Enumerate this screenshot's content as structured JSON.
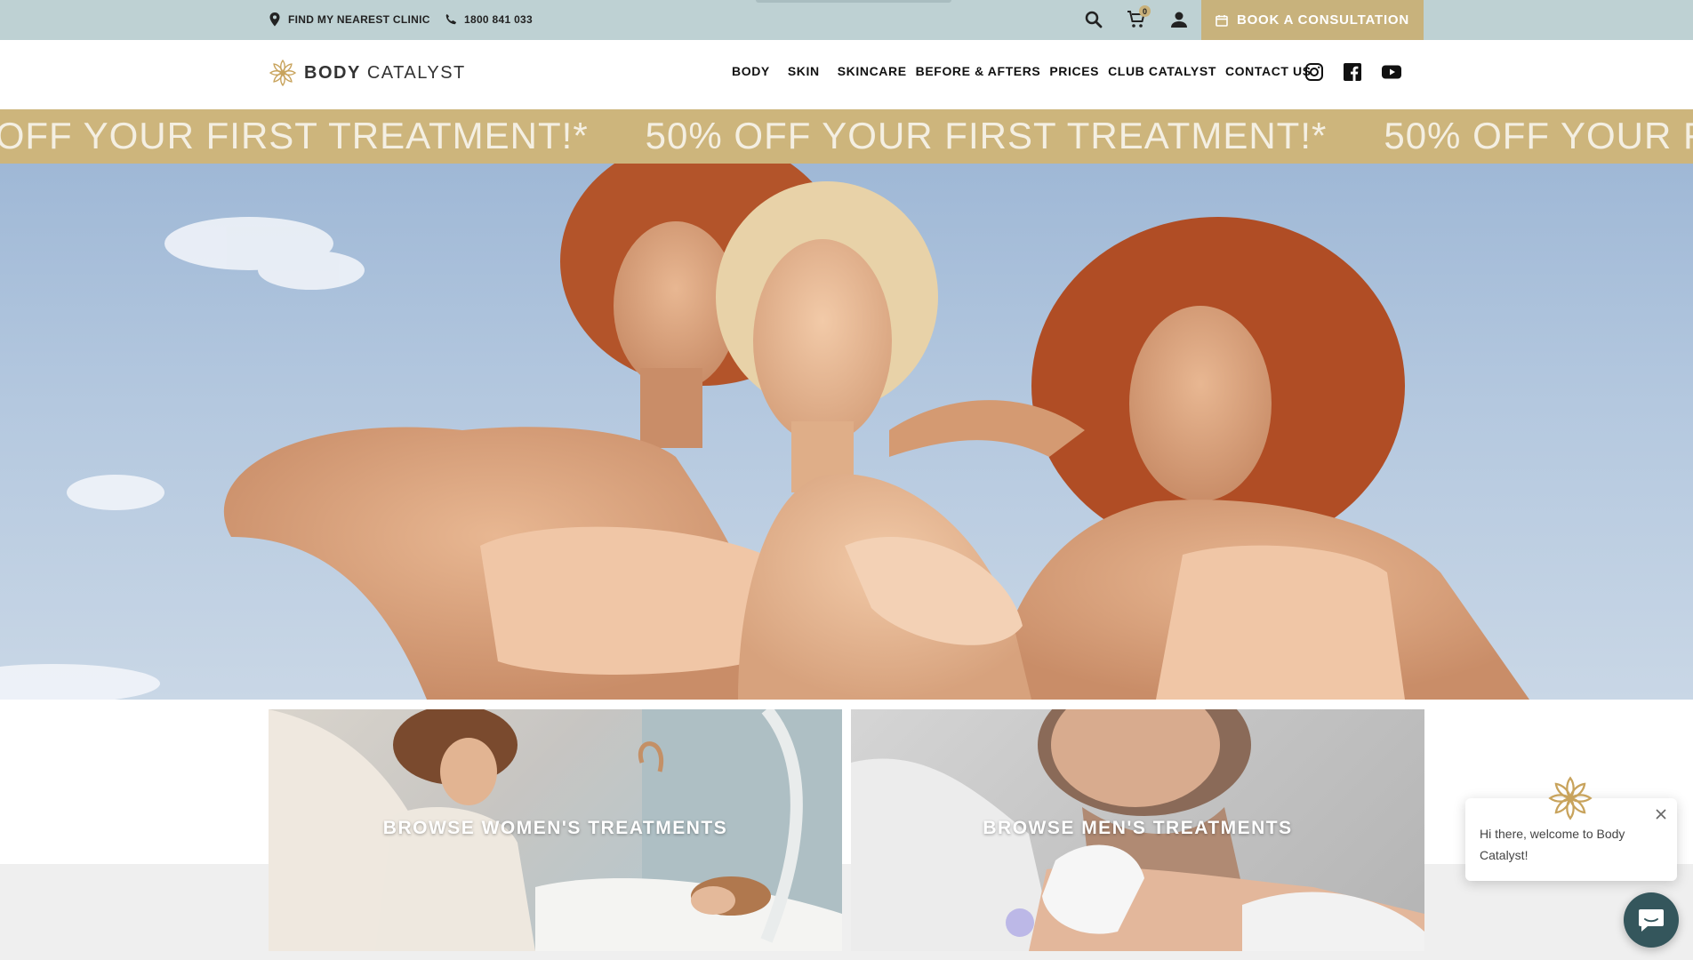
{
  "topbar": {
    "clinic_label": "FIND MY NEAREST CLINIC",
    "phone_label": "1800 841 033",
    "cart_count": "0",
    "book_label": "BOOK A CONSULTATION",
    "icons": [
      "location-pin-icon",
      "phone-icon",
      "search-icon",
      "cart-icon",
      "user-icon",
      "calendar-icon"
    ]
  },
  "nav": {
    "logo_bold": "BODY",
    "logo_light": "CATALYST",
    "items": [
      {
        "label": "BODY"
      },
      {
        "label": "SKIN"
      },
      {
        "label": "SKINCARE"
      },
      {
        "label": "BEFORE & AFTERS"
      },
      {
        "label": "PRICES"
      },
      {
        "label": "CLUB CATALYST"
      },
      {
        "label": "CONTACT US"
      }
    ],
    "social": [
      "instagram-icon",
      "facebook-icon",
      "youtube-icon"
    ]
  },
  "promo": {
    "text": "50% OFF YOUR FIRST TREATMENT!*"
  },
  "tiles": {
    "women_label": "BROWSE WOMEN'S TREATMENTS",
    "men_label": "BROWSE MEN'S TREATMENTS"
  },
  "chat": {
    "message": "Hi there, welcome to Body Catalyst!"
  },
  "colors": {
    "topbar": "#bed1d3",
    "gold": "#c8b27c",
    "promo_text": "#f4efe2"
  }
}
